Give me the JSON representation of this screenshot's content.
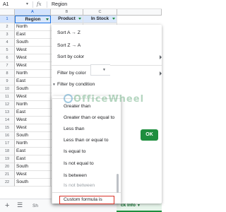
{
  "formula_bar": {
    "cell_ref": "A1",
    "fx": "fx",
    "value": "Region"
  },
  "columns": [
    "A",
    "B",
    "C"
  ],
  "header": {
    "col_a": "Region",
    "col_b": "Product",
    "col_c": "In Stock"
  },
  "rows": [
    {
      "num": "1"
    },
    {
      "num": "2",
      "region": "North"
    },
    {
      "num": "3",
      "region": "East"
    },
    {
      "num": "4",
      "region": "South"
    },
    {
      "num": "5",
      "region": "West"
    },
    {
      "num": "6",
      "region": "West"
    },
    {
      "num": "7",
      "region": "West"
    },
    {
      "num": "8",
      "region": "North"
    },
    {
      "num": "9",
      "region": "East"
    },
    {
      "num": "10",
      "region": "South"
    },
    {
      "num": "11",
      "region": "West"
    },
    {
      "num": "12",
      "region": "North"
    },
    {
      "num": "13",
      "region": "East"
    },
    {
      "num": "14",
      "region": "West"
    },
    {
      "num": "15",
      "region": "West"
    },
    {
      "num": "16",
      "region": "South"
    },
    {
      "num": "17",
      "region": "North"
    },
    {
      "num": "18",
      "region": "East"
    },
    {
      "num": "19",
      "region": "East"
    },
    {
      "num": "20",
      "region": "South"
    },
    {
      "num": "21",
      "region": "West"
    },
    {
      "num": "22",
      "region": "South"
    }
  ],
  "menu": {
    "sort_az": "Sort A → Z",
    "sort_za": "Sort Z → A",
    "sort_by_color": "Sort by color",
    "filter_by_color": "Filter by color",
    "filter_by_condition": "Filter by condition",
    "ok": "OK"
  },
  "condition_options": [
    "Greater than",
    "Greater than or equal to",
    "Less than",
    "Less than or equal to",
    "Is equal to",
    "Is not equal to",
    "Is between",
    "Is not between",
    "Custom formula is"
  ],
  "sheet_tabs": {
    "add": "+",
    "tab1": "Sh",
    "tab2": "ck Info"
  },
  "watermark": "OfficeWheel",
  "colors": {
    "accent": "#1e8e3e",
    "selection": "#1a73e8",
    "highlight": "#d93025"
  }
}
